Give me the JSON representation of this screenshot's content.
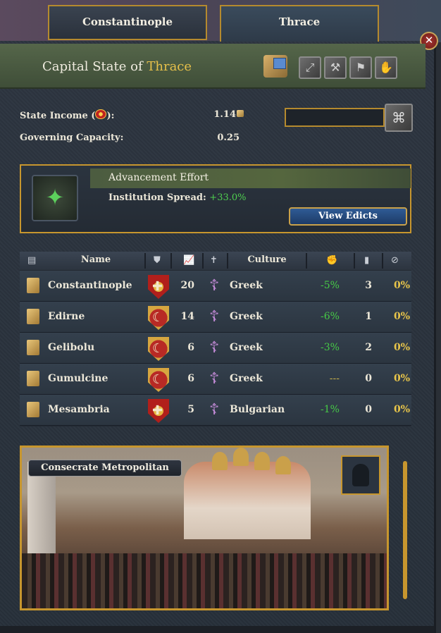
{
  "tabs": [
    {
      "label": "Constantinople",
      "active": false
    },
    {
      "label": "Thrace",
      "active": true
    }
  ],
  "close_label": "✕",
  "header": {
    "title_prefix": "Capital State of",
    "title_name": "Thrace"
  },
  "stats": {
    "income_label": "State Income (",
    "income_label_end": "):",
    "income_value": "1.14",
    "capacity_label": "Governing Capacity:",
    "capacity_value": "0.25"
  },
  "advancement": {
    "title": "Advancement Effort",
    "spread_label": "Institution Spread:",
    "spread_value": "+33.0%",
    "edicts_button": "View Edicts"
  },
  "table": {
    "headers": {
      "name": "Name",
      "culture": "Culture"
    },
    "rows": [
      {
        "name": "Constantinople",
        "owner": "byzantium",
        "dev": "20",
        "culture": "Greek",
        "change": "-5%",
        "count": "3",
        "pct": "0%"
      },
      {
        "name": "Edirne",
        "owner": "ottoman",
        "dev": "14",
        "culture": "Greek",
        "change": "-6%",
        "count": "1",
        "pct": "0%"
      },
      {
        "name": "Gelibolu",
        "owner": "ottoman",
        "dev": "6",
        "culture": "Greek",
        "change": "-3%",
        "count": "2",
        "pct": "0%"
      },
      {
        "name": "Gumulcine",
        "owner": "ottoman",
        "dev": "6",
        "culture": "Greek",
        "change": "---",
        "count": "0",
        "pct": "0%"
      },
      {
        "name": "Mesambria",
        "owner": "byzantium",
        "dev": "5",
        "culture": "Bulgarian",
        "change": "-1%",
        "count": "0",
        "pct": "0%"
      }
    ]
  },
  "event": {
    "title": "Consecrate Metropolitan"
  },
  "colors": {
    "gold_border": "#c7962e",
    "highlight": "#e6c04a",
    "positive": "#4fd04f"
  }
}
